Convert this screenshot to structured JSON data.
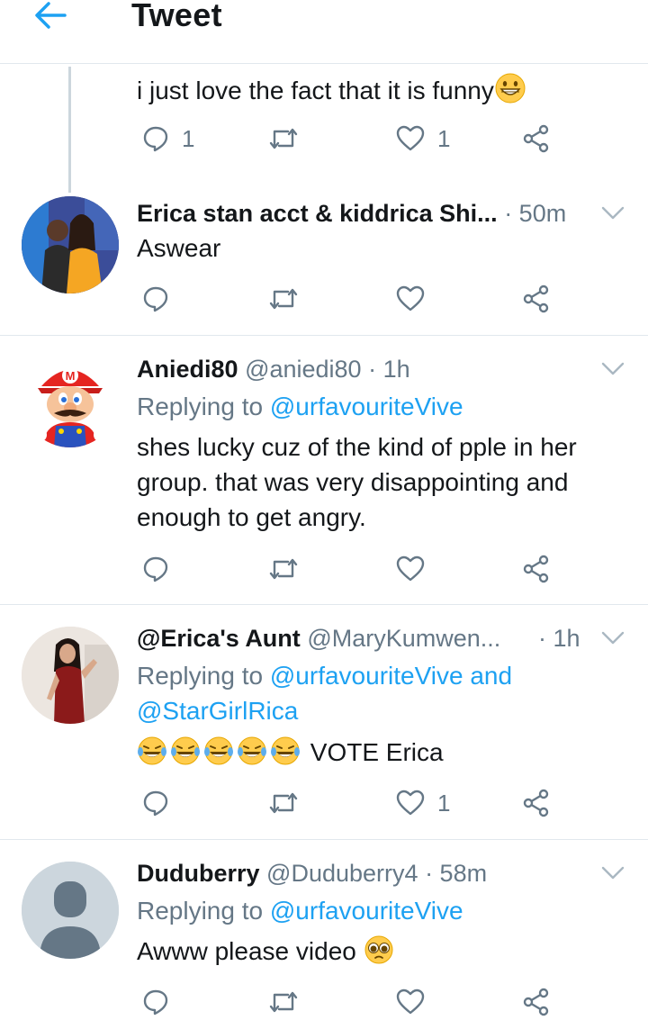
{
  "header": {
    "title": "Tweet"
  },
  "top_tweet": {
    "text": "i just love the fact that it is funny",
    "reply_count": "1",
    "like_count": "1"
  },
  "tweets": [
    {
      "name": "Erica stan acct & kiddrica Shi...",
      "handle": "",
      "time": "· 50m",
      "text": "Aswear",
      "reply_count": "",
      "like_count": ""
    },
    {
      "name": "Aniedi80",
      "handle": "@aniedi80",
      "time": "· 1h",
      "replying_prefix": "Replying to",
      "replying_to": "@urfavouriteVive",
      "text": "shes lucky cuz of the kind of pple in her group. that was very disappointing and enough to get angry.",
      "reply_count": "",
      "like_count": ""
    },
    {
      "name": "@Erica's Aunt",
      "handle": "@MaryKumwen...",
      "time": "· 1h",
      "replying_prefix": "Replying to",
      "replying_to": "@urfavouriteVive and @StarGirlRica",
      "text": "VOTE Erica",
      "reply_count": "",
      "like_count": "1"
    },
    {
      "name": "Duduberry",
      "handle": "@Duduberry4",
      "time": "· 58m",
      "replying_prefix": "Replying to",
      "replying_to": "@urfavouriteVive",
      "text": "Awww please video",
      "reply_count": "",
      "like_count": ""
    }
  ],
  "colors": {
    "accent": "#1da1f2",
    "secondary_text": "#657786",
    "icon": "#657786",
    "divider": "#e1e8ed",
    "emoji": "#ffcc4d"
  }
}
